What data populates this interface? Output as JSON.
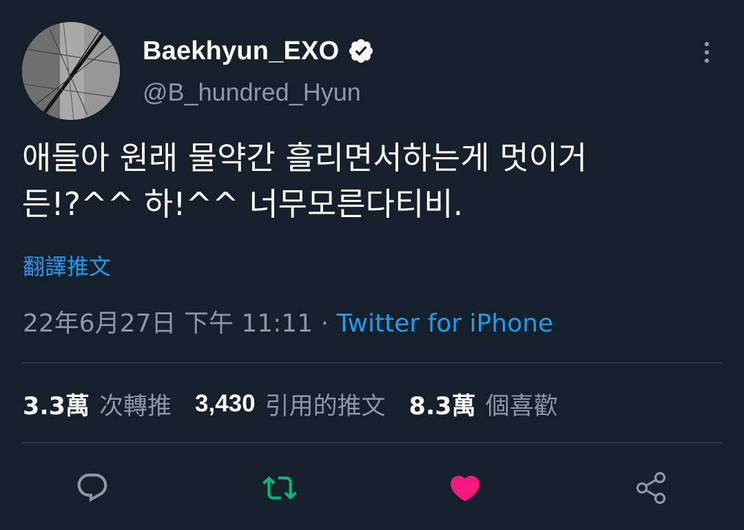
{
  "author": {
    "display_name": "Baekhyun_EXO",
    "handle": "@B_hundred_Hyun",
    "verified": true
  },
  "tweet": {
    "text_line1": "애들아 원래 물약간 흘리면서하는게 멋이거",
    "text_line2": "든!?^^ 하!^^ 너무모른다티비.",
    "translate_label": "翻譯推文",
    "timestamp": "22年6月27日 下午 11:11",
    "separator": " · ",
    "source": "Twitter for iPhone"
  },
  "stats": {
    "retweets_count": "3.3萬",
    "retweets_label": "次轉推",
    "quotes_count": "3,430",
    "quotes_label": "引用的推文",
    "likes_count": "8.3萬",
    "likes_label": "個喜歡"
  },
  "actions": {
    "reply_icon": "reply-icon",
    "retweet_icon": "retweet-icon",
    "like_icon": "heart-icon",
    "share_icon": "share-icon",
    "retweet_color": "#00ba7c",
    "like_color": "#f91880"
  },
  "colors": {
    "background": "#15202b",
    "accent": "#1d9bf0",
    "muted_text": "#8b98a5",
    "divider": "#38444d"
  }
}
